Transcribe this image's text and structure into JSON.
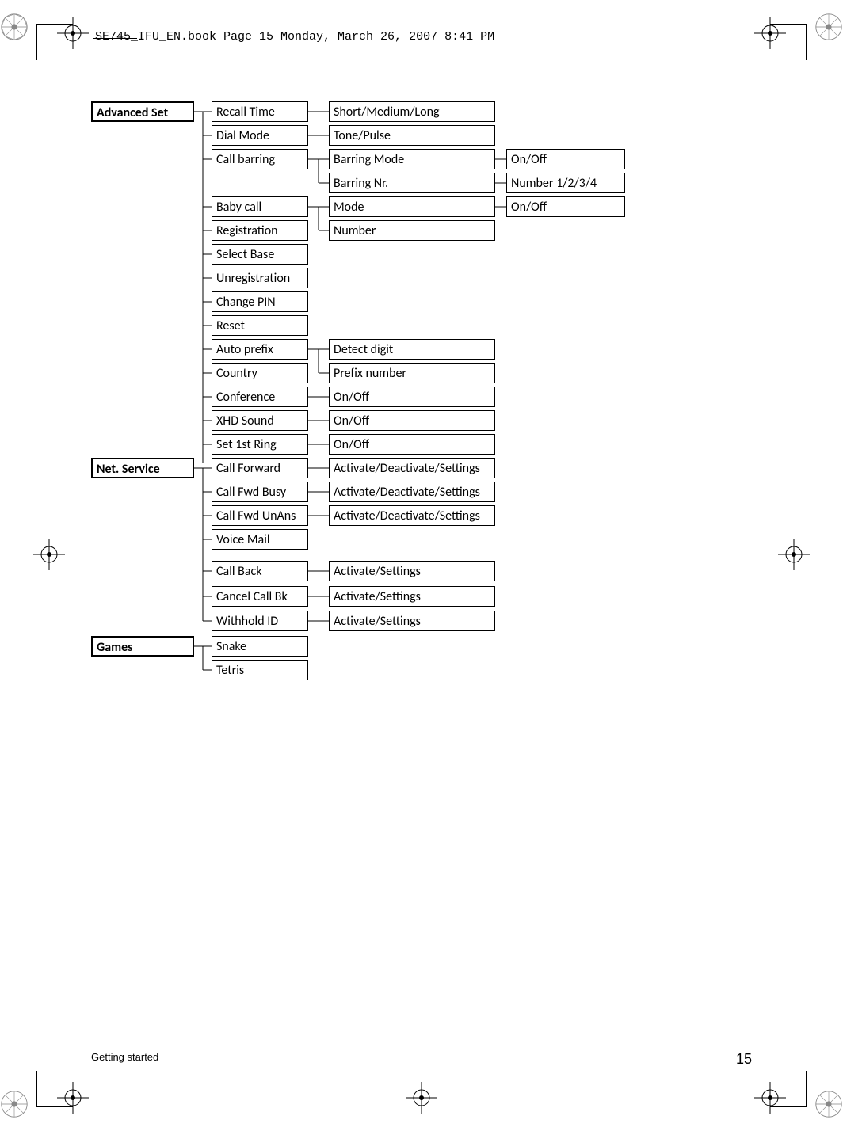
{
  "header": "SE745_IFU_EN.book  Page 15  Monday, March 26, 2007  8:41 PM",
  "footer": {
    "section": "Getting started",
    "page": "15"
  },
  "menu": {
    "advancedSet": {
      "label": "Advanced Set",
      "items": {
        "recallTime": {
          "label": "Recall Time",
          "opts": "Short/Medium/Long"
        },
        "dialMode": {
          "label": "Dial Mode",
          "opts": "Tone/Pulse"
        },
        "callBarring": {
          "label": "Call barring",
          "barringMode": {
            "label": "Barring Mode",
            "opts": "On/Off"
          },
          "barringNr": {
            "label": "Barring Nr.",
            "opts": "Number 1/2/3/4"
          }
        },
        "babyCall": {
          "label": "Baby call",
          "mode": {
            "label": "Mode",
            "opts": "On/Off"
          },
          "number": {
            "label": "Number"
          }
        },
        "registration": "Registration",
        "selectBase": "Select Base",
        "unregistration": "Unregistration",
        "changePin": "Change PIN",
        "reset": "Reset",
        "autoPrefix": {
          "label": "Auto prefix",
          "detect": "Detect digit",
          "prefix": "Prefix number"
        },
        "country": "Country",
        "conference": {
          "label": "Conference",
          "opts": "On/Off"
        },
        "xhdSound": {
          "label": "XHD Sound",
          "opts": "On/Off"
        },
        "set1stRing": {
          "label": "Set 1st Ring",
          "opts": "On/Off"
        }
      }
    },
    "netService": {
      "label": "Net. Service",
      "items": {
        "callForward": {
          "label": "Call Forward",
          "opts": "Activate/Deactivate/Settings"
        },
        "callFwdBusy": {
          "label": "Call Fwd Busy",
          "opts": "Activate/Deactivate/Settings"
        },
        "callFwdUnAns": {
          "label": "Call Fwd UnAns",
          "opts": "Activate/Deactivate/Settings"
        },
        "voiceMail": "Voice Mail",
        "callBack": {
          "label": "Call Back",
          "opts": "Activate/Settings"
        },
        "cancelCallBk": {
          "label": "Cancel Call Bk",
          "opts": "Activate/Settings"
        },
        "withholdId": {
          "label": "Withhold ID",
          "opts": "Activate/Settings"
        }
      }
    },
    "games": {
      "label": "Games",
      "items": {
        "snake": "Snake",
        "tetris": "Tetris"
      }
    }
  }
}
